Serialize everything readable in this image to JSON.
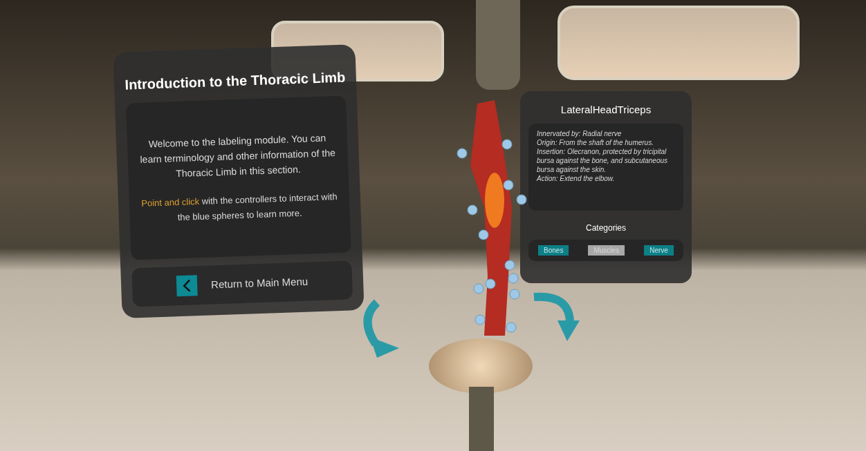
{
  "intro_panel": {
    "title": "Introduction to the Thoracic Limb",
    "paragraph": "Welcome to the labeling module. You can learn terminology and other information of the Thoracic Limb in this section.",
    "hint_highlight": "Point and click",
    "hint_rest": "with the controllers to interact with the blue spheres to learn more.",
    "return_button": "Return to Main Menu"
  },
  "info_panel": {
    "title": "LateralHeadTriceps",
    "lines": [
      "Innervated by: Radial nerve",
      "Origin: From the shaft of the humerus.",
      "Insertion: Olecranon, protected by tricipital bursa against the bone, and subcutaneous bursa against the skin.",
      "Action: Extend the elbow."
    ],
    "categories_title": "Categories",
    "categories": [
      {
        "label": "Bones",
        "selected": false
      },
      {
        "label": "Muscles",
        "selected": true
      },
      {
        "label": "Nerve",
        "selected": false
      }
    ]
  }
}
